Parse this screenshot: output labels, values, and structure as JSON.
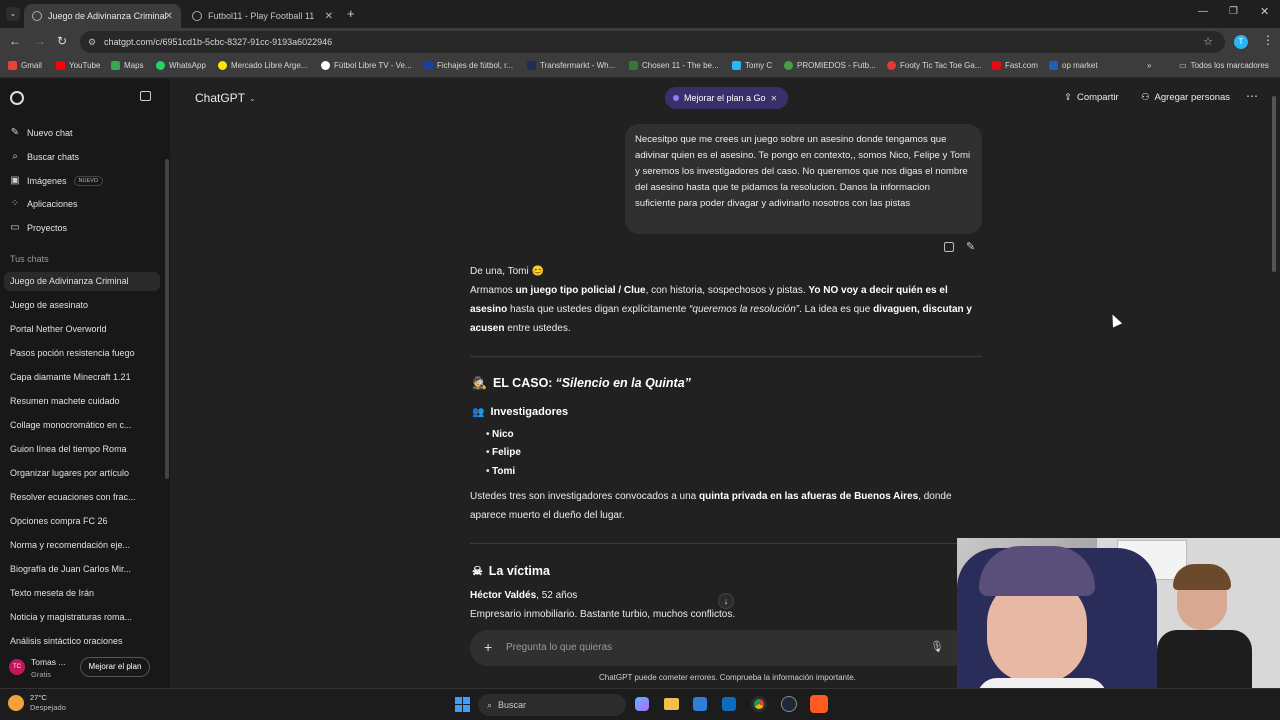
{
  "browser": {
    "tabs": [
      {
        "label": "Juego de Adivinanza Criminal",
        "active": true
      },
      {
        "label": "Futbol11 - Play Football 11",
        "active": false
      }
    ],
    "url": "chatgpt.com/c/6951cd1b-5cbc-8327-91cc-9193a6022946",
    "bookmarks": [
      {
        "label": "Gmail",
        "color": "#ea4335"
      },
      {
        "label": "YouTube",
        "color": "#ff0000"
      },
      {
        "label": "Maps",
        "color": "#34a853"
      },
      {
        "label": "WhatsApp",
        "color": "#25d366"
      },
      {
        "label": "Mercado Libre Arge...",
        "color": "#ffe600"
      },
      {
        "label": "Fútbol Libre TV - Ve...",
        "color": "#ffffff"
      },
      {
        "label": "Fichajes de fútbol, r...",
        "color": "#1d3fa1"
      },
      {
        "label": "Transfermarkt - Wh...",
        "color": "#1a3151"
      },
      {
        "label": "Chosen 11 - The be...",
        "color": "#2e7d32"
      },
      {
        "label": "Tomy C",
        "color": "#29b6f6"
      },
      {
        "label": "PROMIEDOS - Futb...",
        "color": "#43a047"
      },
      {
        "label": "Footy Tic Tac Toe Ga...",
        "color": "#e53935"
      },
      {
        "label": "Fast.com",
        "color": "#e50914"
      },
      {
        "label": "op market",
        "color": "#1565c0"
      }
    ],
    "all_bookmarks": "Todos los marcadores"
  },
  "sidebar": {
    "nav": [
      {
        "label": "Nuevo chat",
        "icon": "edit-icon"
      },
      {
        "label": "Buscar chats",
        "icon": "search-icon"
      },
      {
        "label": "Imágenes",
        "icon": "image-icon",
        "badge": "NUEVO"
      },
      {
        "label": "Aplicaciones",
        "icon": "apps-icon"
      },
      {
        "label": "Proyectos",
        "icon": "folder-icon"
      }
    ],
    "section_title": "Tus chats",
    "chats": [
      "Juego de Adivinanza Criminal",
      "Juego de asesinato",
      "Portal Nether Overworld",
      "Pasos poción resistencia fuego",
      "Capa diamante Minecraft 1.21",
      "Resumen machete cuidado",
      "Collage monocromático en c...",
      "Guion línea del tiempo Roma",
      "Organizar lugares por artículo",
      "Resolver ecuaciones con frac...",
      "Opciones compra FC 26",
      "Norma y recomendación eje...",
      "Biografía de Juan Carlos Mir...",
      "Texto meseta de Irán",
      "Noticia y magistraturas roma...",
      "Análisis sintáctico oraciones"
    ],
    "user": {
      "name": "Tomas ...",
      "plan": "Gratis",
      "initials": "TC"
    },
    "upgrade_button": "Mejorar el plan"
  },
  "header": {
    "model": "ChatGPT",
    "upgrade_pill": "Mejorar el plan a Go",
    "share": "Compartir",
    "add_people": "Agregar personas"
  },
  "conversation": {
    "user_message": "Necesitpo que me crees un juego sobre un asesino donde tengamos que adivinar quien es el asesino. Te pongo en contexto,, somos Nico, Felipe y Tomi y seremos los investigadores del caso. No queremos que nos digas el nombre del asesino hasta que te pidamos la resolucion. Danos la informacion suficiente para poder divagar y adivinarlo nosotros con las pistas",
    "greeting": "De una, Tomi 😊",
    "intro_1": "Armamos ",
    "intro_b1": "un juego tipo policial / Clue",
    "intro_2": ", con historia, sospechosos y pistas. ",
    "intro_b2": "Yo NO voy a decir quién es el asesino",
    "intro_3": " hasta que ustedes digan explícitamente ",
    "intro_i": "“queremos la resolución”",
    "intro_4": ". La idea es que ",
    "intro_b3": "divaguen, discutan y acusen",
    "intro_5": " entre ustedes.",
    "case_prefix": "EL CASO: ",
    "case_title": "“Silencio en la Quinta”",
    "investigators_title": "Investigadores",
    "investigators": [
      "Nico",
      "Felipe",
      "Tomi"
    ],
    "summons_1": "Ustedes tres son investigadores convocados a una ",
    "summons_b": "quinta privada en las afueras de Buenos Aires",
    "summons_2": ", donde aparece muerto el dueño del lugar.",
    "victim_title": "La víctima",
    "victim_name": "Héctor Valdés",
    "victim_age": ", 52 años",
    "victim_desc": "Empresario inmobiliario. Bastante turbio, muchos conflictos."
  },
  "composer": {
    "placeholder": "Pregunta lo que quieras",
    "disclaimer": "ChatGPT puede cometer errores. Comprueba la información importante."
  },
  "taskbar": {
    "weather_temp": "27°C",
    "weather_desc": "Despejado",
    "search": "Buscar"
  }
}
